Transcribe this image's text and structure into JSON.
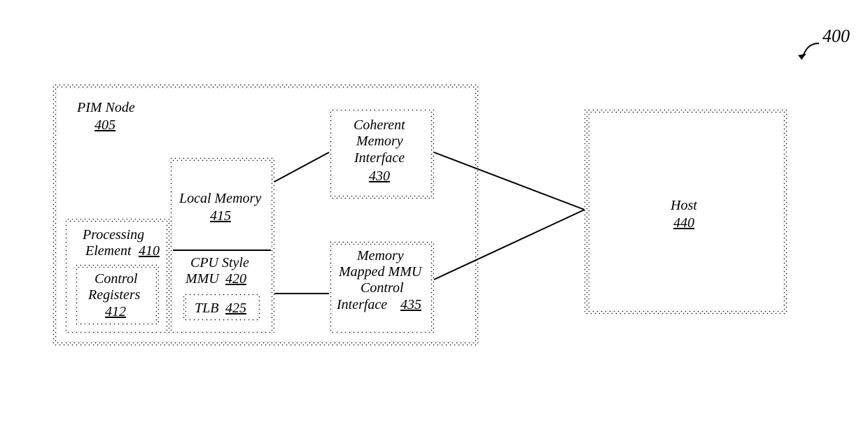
{
  "figure_number": "400",
  "pim_node": {
    "label": "PIM Node",
    "ref": "405"
  },
  "processing_element": {
    "label1": "Processing",
    "label2": "Element",
    "ref": "410"
  },
  "control_registers": {
    "label1": "Control",
    "label2": "Registers",
    "ref": "412"
  },
  "local_memory": {
    "label": "Local Memory",
    "ref": "415"
  },
  "cpu_mmu": {
    "label1": "CPU Style",
    "label2": "MMU",
    "ref": "420"
  },
  "tlb": {
    "label": "TLB",
    "ref": "425"
  },
  "coherent_if": {
    "line1": "Coherent",
    "line2": "Memory",
    "line3": "Interface",
    "ref": "430"
  },
  "mmapped_if": {
    "line1": "Memory",
    "line2": "Mapped MMU",
    "line3": "Control",
    "line4": "Interface",
    "ref": "435"
  },
  "host": {
    "label": "Host",
    "ref": "440"
  }
}
